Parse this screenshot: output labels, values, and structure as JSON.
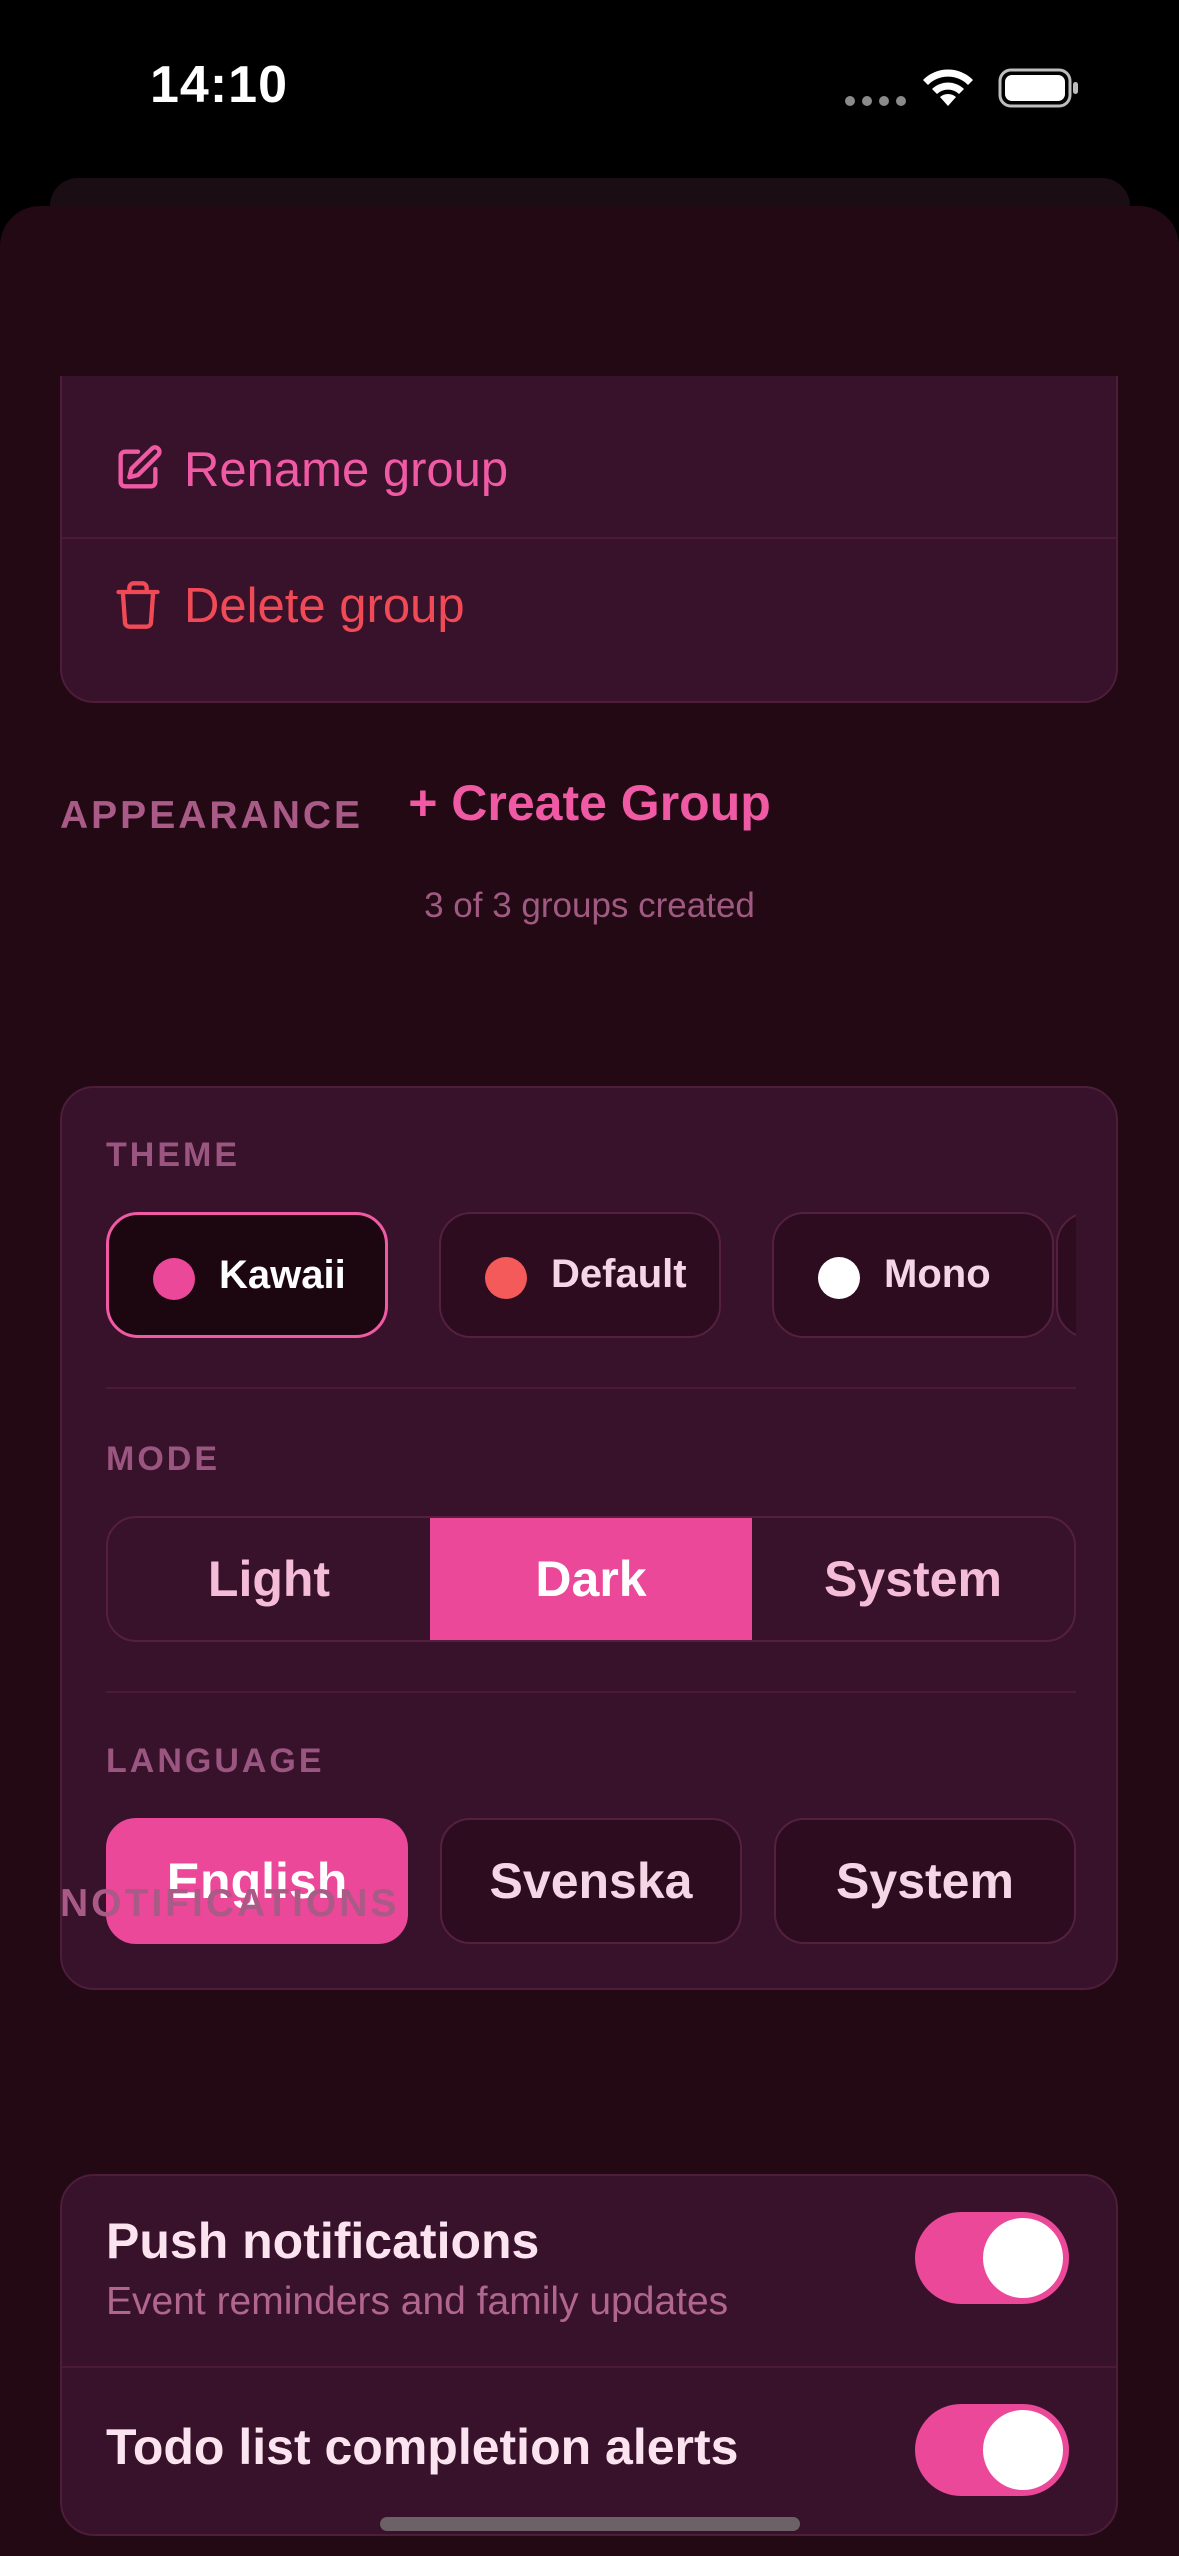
{
  "status_bar": {
    "time": "14:10"
  },
  "groups": {
    "rename_label": "Rename group",
    "delete_label": "Delete group",
    "create_label": "+ Create Group",
    "count_text": "3 of 3 groups created"
  },
  "appearance": {
    "header": "APPEARANCE",
    "theme_header": "THEME",
    "themes": [
      {
        "label": "Kawaii",
        "color": "#ec4899",
        "selected": true
      },
      {
        "label": "Default",
        "color": "#f55a5a",
        "selected": false
      },
      {
        "label": "Mono",
        "color": "#ffffff",
        "selected": false
      }
    ],
    "mode_header": "MODE",
    "modes": [
      {
        "label": "Light",
        "active": false
      },
      {
        "label": "Dark",
        "active": true
      },
      {
        "label": "System",
        "active": false
      }
    ],
    "language_header": "LANGUAGE",
    "languages": [
      {
        "label": "English",
        "active": true
      },
      {
        "label": "Svenska",
        "active": false
      },
      {
        "label": "System",
        "active": false
      }
    ]
  },
  "notifications": {
    "header": "NOTIFICATIONS",
    "push_title": "Push notifications",
    "push_subtitle": "Event reminders and family updates",
    "push_enabled": true,
    "todo_title": "Todo list completion alerts",
    "todo_enabled": true
  },
  "colors": {
    "accent": "#ec4899",
    "danger": "#f04a57",
    "background": "#220914",
    "card": "#37122a"
  }
}
